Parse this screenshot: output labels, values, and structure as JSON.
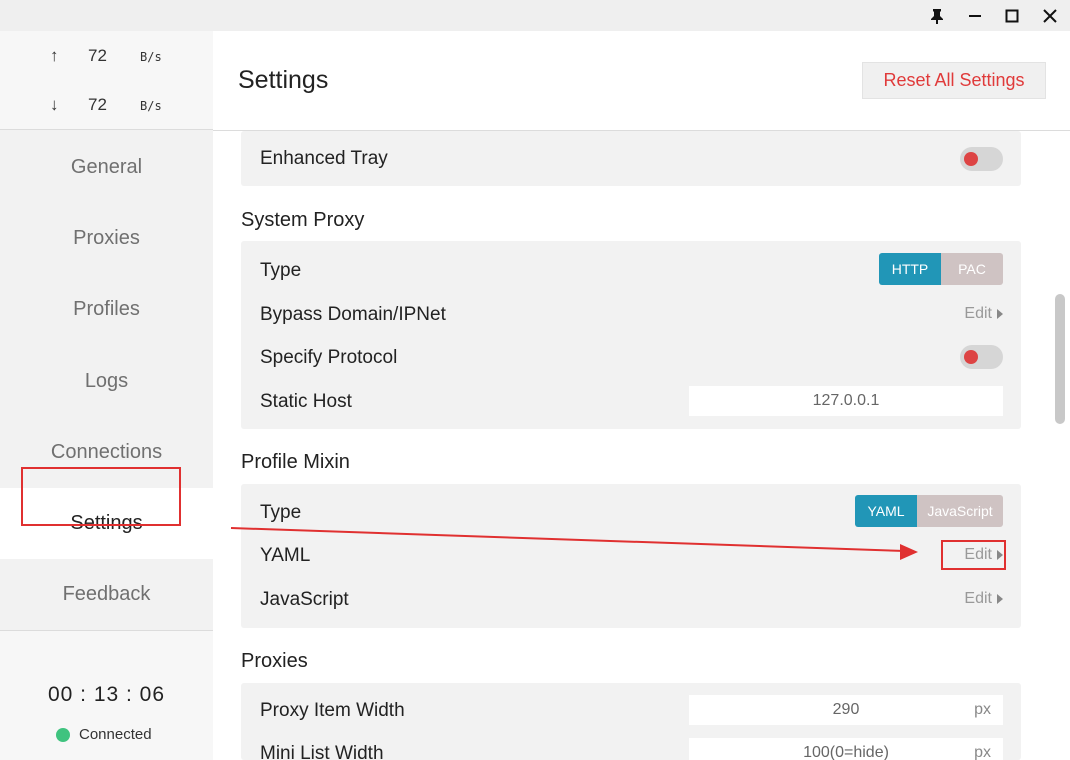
{
  "titlebar": {
    "pin_icon": "pin-icon",
    "minimize_icon": "minimize-icon",
    "maximize_icon": "maximize-icon",
    "close_icon": "close-icon"
  },
  "traffic": {
    "up_arrow": "↑",
    "up_value": "72",
    "up_unit": "B/s",
    "down_arrow": "↓",
    "down_value": "72",
    "down_unit": "B/s"
  },
  "nav": {
    "general": "General",
    "proxies": "Proxies",
    "profiles": "Profiles",
    "logs": "Logs",
    "connections": "Connections",
    "settings": "Settings",
    "feedback": "Feedback"
  },
  "status": {
    "clock": "00 : 13 : 06",
    "state": "Connected",
    "color": "#3fc37f"
  },
  "header": {
    "title": "Settings",
    "reset_label": "Reset All Settings"
  },
  "general": {
    "enhanced_tray_label": "Enhanced Tray"
  },
  "system_proxy": {
    "title": "System Proxy",
    "type_label": "Type",
    "type_options": [
      "HTTP",
      "PAC"
    ],
    "type_selected": "HTTP",
    "bypass_label": "Bypass Domain/IPNet",
    "bypass_edit": "Edit",
    "specify_label": "Specify Protocol",
    "static_host_label": "Static Host",
    "static_host_value": "127.0.0.1"
  },
  "profile_mixin": {
    "title": "Profile Mixin",
    "type_label": "Type",
    "type_options": [
      "YAML",
      "JavaScript"
    ],
    "type_selected": "YAML",
    "yaml_label": "YAML",
    "yaml_edit": "Edit",
    "js_label": "JavaScript",
    "js_edit": "Edit"
  },
  "proxies": {
    "title": "Proxies",
    "item_width_label": "Proxy Item Width",
    "item_width_value": "290",
    "item_width_unit": "px",
    "mini_list_label": "Mini List Width",
    "mini_list_value": "100(0=hide)",
    "mini_list_unit": "px"
  },
  "colors": {
    "accent": "#2196b7",
    "danger": "#e03a3a",
    "annotation": "#e03030"
  }
}
